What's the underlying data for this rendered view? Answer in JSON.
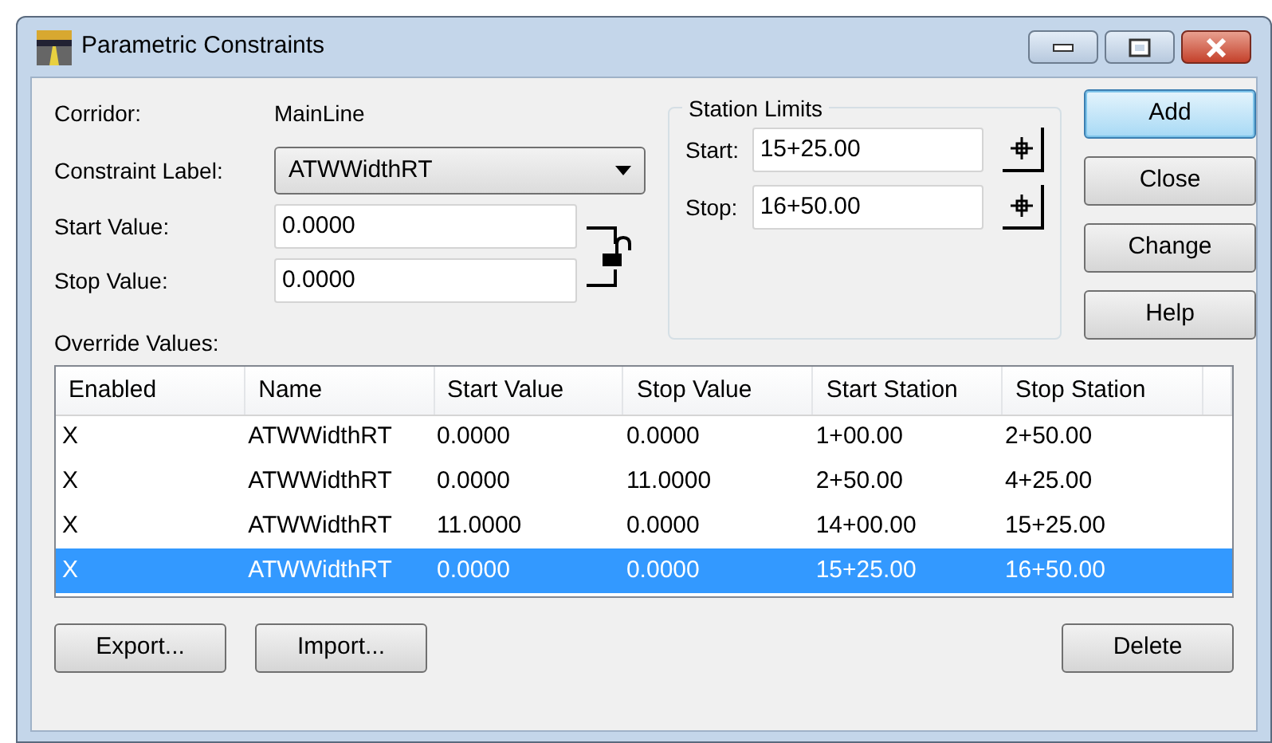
{
  "window": {
    "title": "Parametric Constraints"
  },
  "corridor": {
    "label": "Corridor:",
    "value": "MainLine"
  },
  "constraint_label": {
    "label": "Constraint Label:",
    "value": "ATWWidthRT"
  },
  "start_value": {
    "label": "Start Value:",
    "value": "0.0000"
  },
  "stop_value": {
    "label": "Stop Value:",
    "value": "0.0000"
  },
  "station_limits": {
    "title": "Station Limits",
    "fields": [
      {
        "label": "Start:",
        "value": "15+25.00"
      },
      {
        "label": "Stop:",
        "value": "16+50.00"
      }
    ]
  },
  "side_buttons": [
    {
      "label": "Add",
      "default": true
    },
    {
      "label": "Close",
      "default": false
    },
    {
      "label": "Change",
      "default": false
    },
    {
      "label": "Help",
      "default": false
    }
  ],
  "override_values": {
    "label": "Override Values:",
    "columns": [
      "Enabled",
      "Name",
      "Start Value",
      "Stop Value",
      "Start Station",
      "Stop Station"
    ],
    "rows": [
      {
        "cells": [
          "X",
          "ATWWidthRT",
          "0.0000",
          "0.0000",
          "1+00.00",
          "2+50.00"
        ],
        "selected": false
      },
      {
        "cells": [
          "X",
          "ATWWidthRT",
          "0.0000",
          "11.0000",
          "2+50.00",
          "4+25.00"
        ],
        "selected": false
      },
      {
        "cells": [
          "X",
          "ATWWidthRT",
          "11.0000",
          "0.0000",
          "14+00.00",
          "15+25.00"
        ],
        "selected": false
      },
      {
        "cells": [
          "X",
          "ATWWidthRT",
          "0.0000",
          "0.0000",
          "15+25.00",
          "16+50.00"
        ],
        "selected": true
      }
    ]
  },
  "left_buttons": [
    "Export...",
    "Import..."
  ],
  "right_buttons": [
    "Delete"
  ]
}
